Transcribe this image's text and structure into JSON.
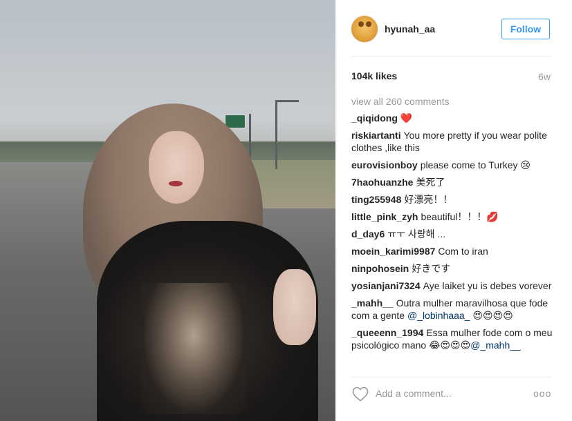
{
  "header": {
    "username": "hyunah_aa",
    "follow_label": "Follow"
  },
  "stats": {
    "likes": "104k likes",
    "time": "6w"
  },
  "comments": {
    "view_all": "view all 260 comments",
    "items": [
      {
        "user": "_qiqidong",
        "text": "❤️"
      },
      {
        "user": "riskiartanti",
        "text": "You more pretty if you wear polite clothes ,like this"
      },
      {
        "user": "eurovisionboy",
        "text": "please come to Turkey 😢"
      },
      {
        "user": "7haohuanzhe",
        "text": "美死了"
      },
      {
        "user": "ting255948",
        "text": "好漂亮！！"
      },
      {
        "user": "little_pink_zyh",
        "text": "beautiful！！！💋"
      },
      {
        "user": "d_day6",
        "text": "ㅠㅜ 사랑해 ..."
      },
      {
        "user": "moein_karimi9987",
        "text": "Com to iran"
      },
      {
        "user": "ninpohosein",
        "text": "好きです"
      },
      {
        "user": "yosianjani7324",
        "text": "Aye laiket yu is debes vorever"
      },
      {
        "user": "_mahh__",
        "text": "Outra mulher maravilhosa que fode com a gente",
        "mention": "@_lobinhaaa_",
        "suffix": "😍😍😍😍"
      },
      {
        "user": "_queeenn_1994",
        "text": "Essa mulher fode com o meu psicológico mano",
        "prefix_emoji": "😂😍😍😍",
        "mention": "@_mahh__"
      }
    ]
  },
  "add_comment": {
    "placeholder": "Add a comment...",
    "more_label": "ooo"
  },
  "icons": {
    "avatar": "avatar-image",
    "heart": "heart-outline-icon",
    "more": "more-options-icon"
  },
  "colors": {
    "follow_blue": "#3897f0",
    "mention": "#003569",
    "muted": "#999999"
  }
}
